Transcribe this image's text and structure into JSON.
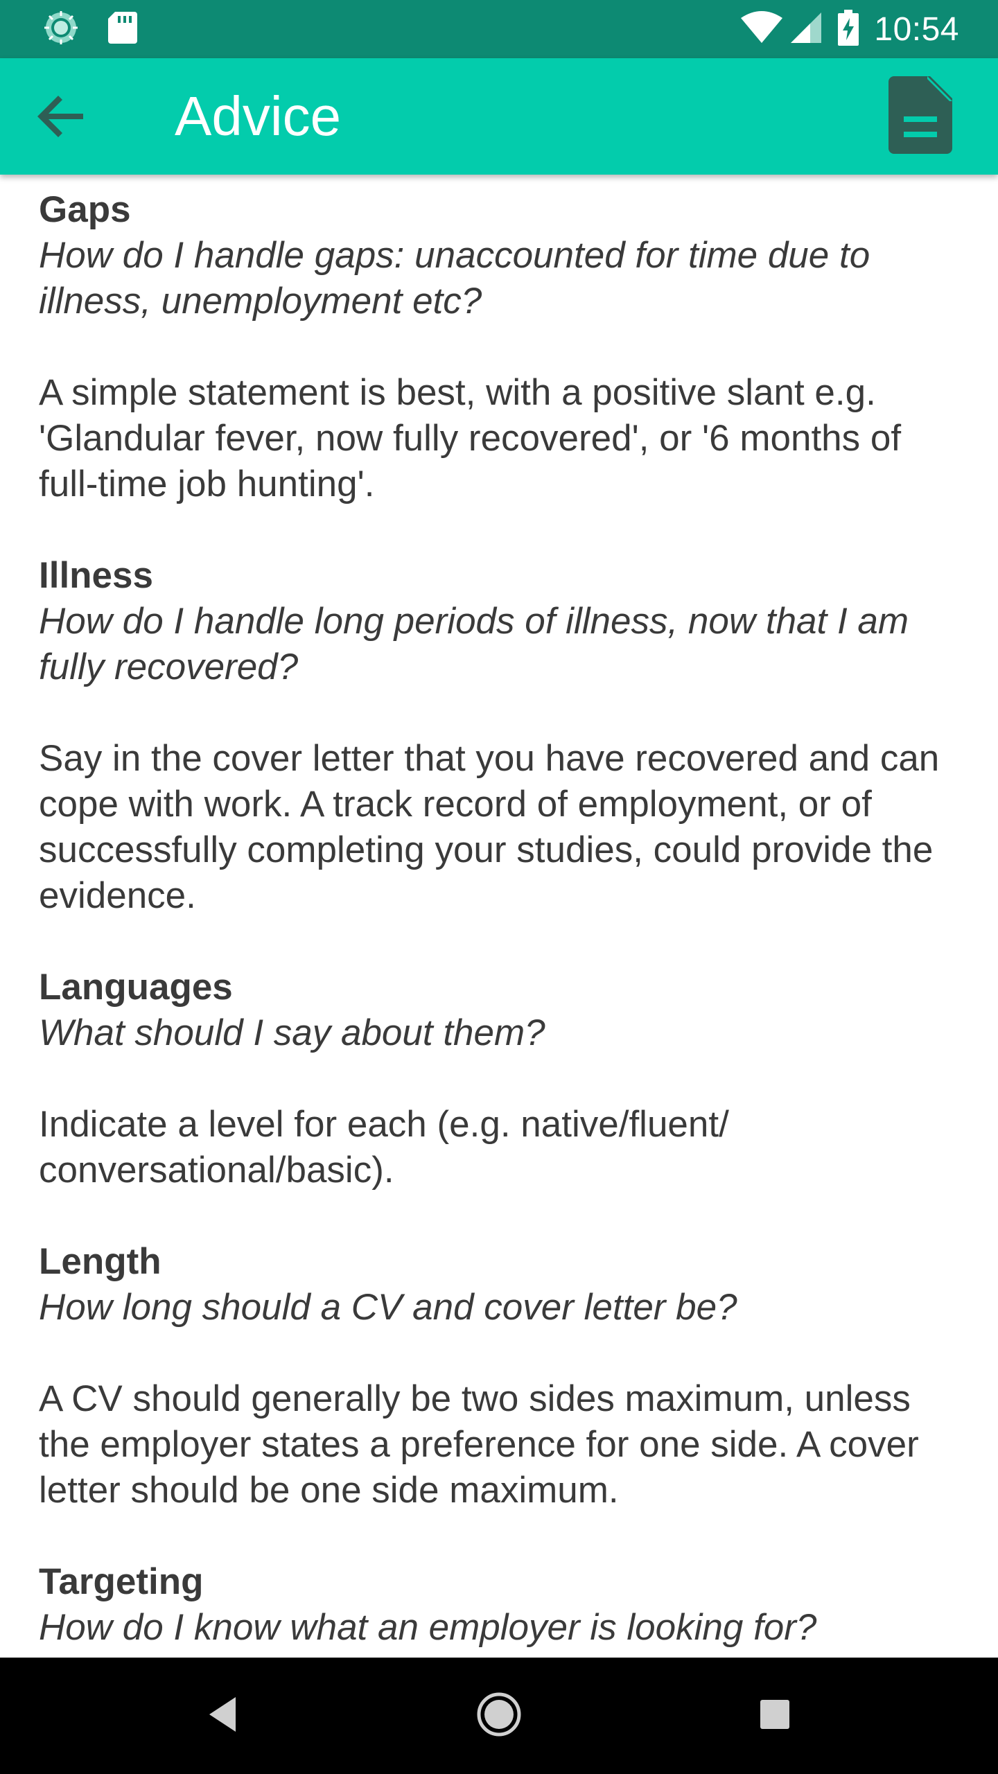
{
  "status_bar": {
    "time": "10:54",
    "icons": [
      "sync-icon",
      "sd-card-icon",
      "wifi-icon",
      "cellular-signal-icon",
      "battery-charging-icon"
    ]
  },
  "app_bar": {
    "title": "Advice",
    "back_icon": "arrow-back-icon",
    "action_icon": "document-icon"
  },
  "sections": [
    {
      "title": "Gaps",
      "question": "How do I handle gaps: unaccounted for time due to illness, unemployment etc?",
      "answer": "A simple statement is best, with a positive slant e.g. 'Glandular fever, now fully recovered', or '6 months of full-time job hunting'."
    },
    {
      "title": "Illness",
      "question": "How do I handle long periods of illness, now that I am fully recovered?",
      "answer": "Say in the cover letter that you have recovered and can cope with work. A track record of employment, or of successfully completing your studies, could provide the evidence."
    },
    {
      "title": "Languages",
      "question": "What should I say about them?",
      "answer": "Indicate a level for each (e.g. native/fluent/ conversational/basic)."
    },
    {
      "title": "Length",
      "question": "How long should a CV and cover letter be?",
      "answer": "A CV should generally be two sides maximum, unless the employer states a preference for one side. A cover letter should be one side maximum."
    },
    {
      "title": "Targeting",
      "question": "How do I know what an employer is looking for?",
      "answer": ""
    }
  ],
  "nav_bar": {
    "icons": [
      "nav-back-icon",
      "nav-home-icon",
      "nav-recents-icon"
    ]
  },
  "colors": {
    "status_bar": "#0d8a73",
    "app_bar": "#03ccac",
    "icon_dark": "#2e5f55",
    "text": "#3a3a3a"
  }
}
